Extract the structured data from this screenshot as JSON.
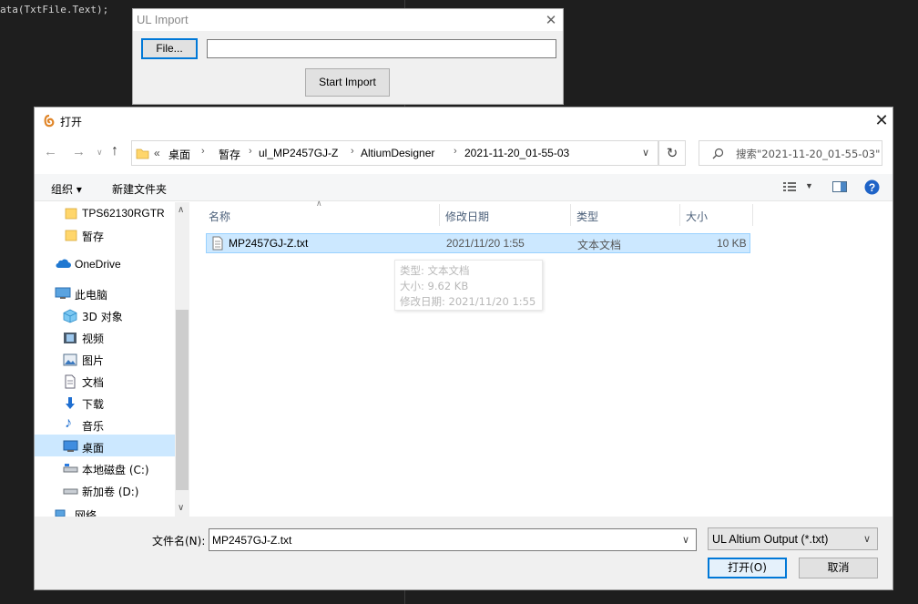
{
  "editor": {
    "code_line": "ata(TxtFile.Text);"
  },
  "ul_import": {
    "title": "UL Import",
    "file_button": "File...",
    "path_value": "",
    "start_button": "Start Import"
  },
  "dialog": {
    "title": "打开",
    "breadcrumb": [
      "桌面",
      "暂存",
      "ul_MP2457GJ-Z",
      "AltiumDesigner",
      "2021-11-20_01-55-03"
    ],
    "breadcrumb_overflow": "«",
    "search_placeholder": "搜索\"2021-11-20_01-55-03\"",
    "toolbar": {
      "organize": "组织 ▾",
      "new_folder": "新建文件夹"
    },
    "nav": {
      "items": [
        {
          "label": "TPS62130RGTR",
          "icon": "folder-icon"
        },
        {
          "label": "暂存",
          "icon": "folder-icon"
        },
        {
          "label": "OneDrive",
          "icon": "cloud-icon"
        },
        {
          "label": "此电脑",
          "icon": "computer-icon"
        },
        {
          "label": "3D 对象",
          "icon": "cube-icon"
        },
        {
          "label": "视频",
          "icon": "video-icon"
        },
        {
          "label": "图片",
          "icon": "picture-icon"
        },
        {
          "label": "文档",
          "icon": "document-icon"
        },
        {
          "label": "下载",
          "icon": "download-icon"
        },
        {
          "label": "音乐",
          "icon": "music-icon"
        },
        {
          "label": "桌面",
          "icon": "desktop-icon"
        },
        {
          "label": "本地磁盘 (C:)",
          "icon": "drive-icon"
        },
        {
          "label": "新加卷 (D:)",
          "icon": "drive-icon"
        },
        {
          "label": "网络",
          "icon": "network-icon"
        }
      ],
      "selected": "桌面"
    },
    "columns": {
      "name": "名称",
      "modified": "修改日期",
      "type": "类型",
      "size": "大小"
    },
    "files": [
      {
        "name": "MP2457GJ-Z.txt",
        "modified": "2021/11/20 1:55",
        "type": "文本文档",
        "size": "10 KB"
      }
    ],
    "tooltip": {
      "type": "类型: 文本文档",
      "size": "大小: 9.62 KB",
      "modified": "修改日期: 2021/11/20 1:55"
    },
    "filename_label": "文件名(N):",
    "filename_value": "MP2457GJ-Z.txt",
    "filetype_value": "UL Altium Output (*.txt)",
    "open_button": "打开(O)",
    "cancel_button": "取消",
    "accent_color": "#0078d7",
    "selection_color": "#cce8ff"
  }
}
